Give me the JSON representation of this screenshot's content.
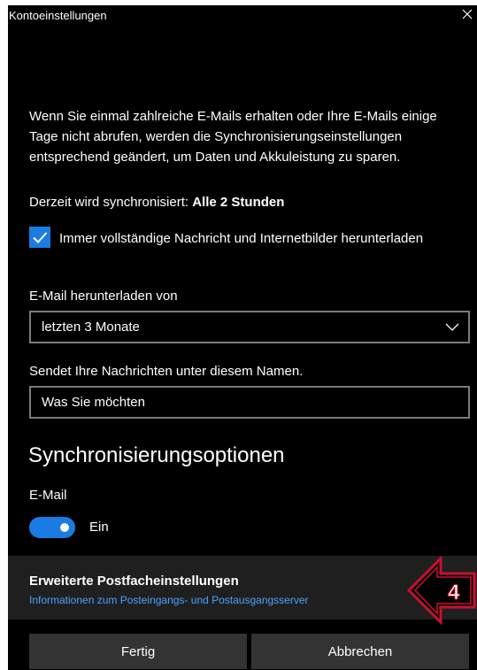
{
  "window": {
    "title": "Kontoeinstellungen"
  },
  "description": "Wenn Sie einmal zahlreiche E-Mails erhalten oder Ihre E-Mails einige Tage nicht abrufen, werden die Synchronisierungseinstellungen entsprechend geändert, um Daten und Akkuleistung zu sparen.",
  "sync_status": {
    "prefix": "Derzeit wird synchronisiert: ",
    "value": "Alle 2 Stunden"
  },
  "full_download_checkbox": {
    "label": "Immer vollständige Nachricht und Internetbilder herunterladen",
    "checked": true
  },
  "download_from": {
    "label": "E-Mail herunterladen von",
    "selected": "letzten 3 Monate"
  },
  "sender_name": {
    "label": "Sendet Ihre Nachrichten unter diesem Namen.",
    "value": "Was Sie möchten"
  },
  "sync_options": {
    "heading": "Synchronisierungsoptionen",
    "email_label": "E-Mail",
    "email_toggle_state": "Ein",
    "email_enabled": true
  },
  "advanced": {
    "title": "Erweiterte Postfacheinstellungen",
    "link": "Informationen zum Posteingangs- und Postausgangsserver"
  },
  "annotation": {
    "step_number": "4",
    "color": "#c8102e"
  },
  "buttons": {
    "done": "Fertig",
    "cancel": "Abbrechen"
  },
  "colors": {
    "accent": "#1a7ce0",
    "link": "#4aa3ff",
    "background": "#000000"
  }
}
